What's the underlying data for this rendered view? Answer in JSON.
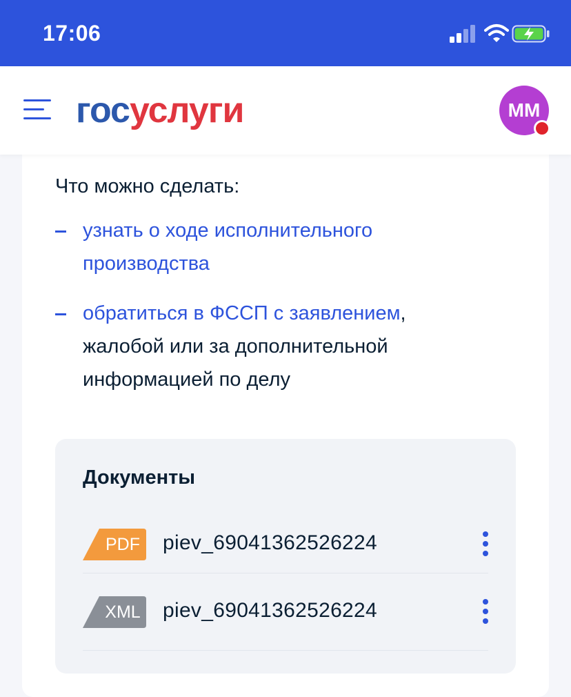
{
  "status_bar": {
    "time": "17:06",
    "icons": [
      "cellular-signal-icon",
      "wifi-icon",
      "battery-charging-icon"
    ]
  },
  "header": {
    "logo_part1": "гос",
    "logo_part2": "услуги",
    "avatar_initials": "ММ",
    "menu_icon": "hamburger-menu-icon",
    "colors": {
      "brand_blue": "#2d53dc",
      "logo_red": "#e0363f",
      "avatar": "#b43ed2"
    }
  },
  "content": {
    "heading": "Что можно сделать:",
    "items": [
      {
        "link_line1": "узнать о ходе исполнительного",
        "link_line2": "производства"
      },
      {
        "link": "обратиться в ФССП с заявлением",
        "after_link": ",",
        "line2": "жалобой или за дополнительной",
        "line3": "информацией по делу"
      }
    ]
  },
  "documents": {
    "title": "Документы",
    "files": [
      {
        "type": "PDF",
        "name": "piev_69041362526224",
        "badge_color": "#f39a3d"
      },
      {
        "type": "XML",
        "name": "piev_69041362526224",
        "badge_color": "#8a8f97"
      }
    ]
  }
}
